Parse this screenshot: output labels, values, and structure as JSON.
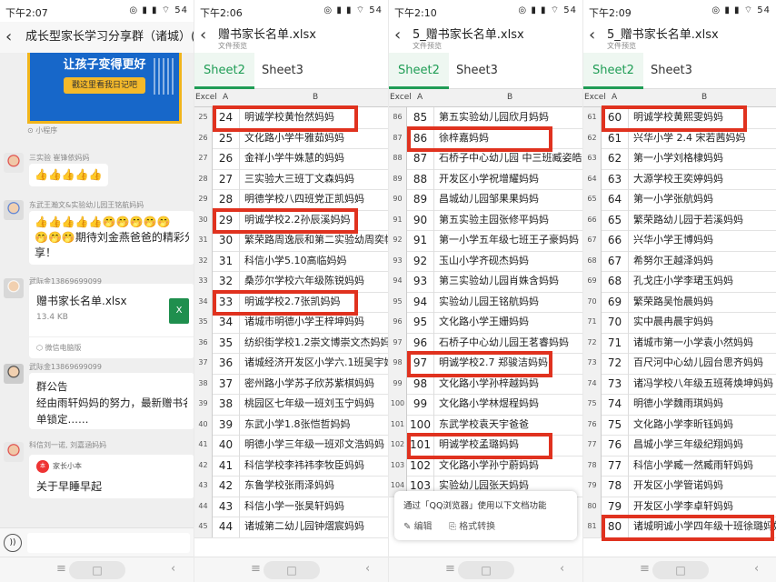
{
  "chat": {
    "status_time": "下午2:07",
    "title": "成长型家长学习分享群（诸城）(49",
    "banner_line1": "让孩子变得更好",
    "banner_btn": "戳这里看我日记吧",
    "mini_program": "小程序",
    "msg1_sender": "三实验 崔锋依妈妈",
    "msg1_text": "👍👍👍👍👍",
    "msg2_sender": "东武王瀚文&实验幼儿园王铭航妈妈",
    "msg2_line1": "👍👍👍👍👍🤭🤭🤭🤭🤭",
    "msg2_line2": "🤭🤭🤭期待刘金燕爸爸的精彩分",
    "msg2_line3": "享！",
    "msg3_sender": "武际金13869699099",
    "file_name": "赠书家长名单.xlsx",
    "file_size": "13.4 KB",
    "file_source": "微信电脑版",
    "msg4_sender": "武际金13869699099",
    "notice_title": "群公告",
    "notice_line1": "经由雨轩妈妈的努力，最新赠书名",
    "notice_line2": "单锁定……",
    "msg5_sender": "科信刘一诺, 刘嘉涵妈妈",
    "card_brand": "家长小本",
    "card_title": "关于早睡早起"
  },
  "sheets": [
    {
      "status_time": "下午2:06",
      "file_name": "赠书家长名单.xlsx",
      "file_sub": "文件预览",
      "tabs": [
        "Sheet2",
        "Sheet3"
      ],
      "rows": [
        {
          "r": "25",
          "a": "24",
          "b": "明诚学校黄怡然妈妈"
        },
        {
          "r": "26",
          "a": "25",
          "b": "文化路小学牛雅茹妈妈"
        },
        {
          "r": "27",
          "a": "26",
          "b": "金祥小学牛姝慧的妈妈"
        },
        {
          "r": "28",
          "a": "27",
          "b": "三实验大三班丁文森妈妈"
        },
        {
          "r": "29",
          "a": "28",
          "b": "明德学校八四班党正凯妈妈"
        },
        {
          "r": "30",
          "a": "29",
          "b": "明诚学校2.2孙辰溪妈妈"
        },
        {
          "r": "31",
          "a": "30",
          "b": "繁荣路周逸辰和第二实验幼周奕帆"
        },
        {
          "r": "32",
          "a": "31",
          "b": "科信小学5.10高临妈妈"
        },
        {
          "r": "33",
          "a": "32",
          "b": "桑莎尔学校六年级陈锐妈妈"
        },
        {
          "r": "34",
          "a": "33",
          "b": "明诚学校2.7张凯妈妈"
        },
        {
          "r": "35",
          "a": "34",
          "b": "诸城市明德小学王梓坤妈妈"
        },
        {
          "r": "36",
          "a": "35",
          "b": "纺织街学校1.2崇文博崇文杰妈妈"
        },
        {
          "r": "37",
          "a": "36",
          "b": "诸城经济开发区小学六.1班吴宇妈"
        },
        {
          "r": "38",
          "a": "37",
          "b": "密州路小学苏子欣苏紫棋妈妈"
        },
        {
          "r": "39",
          "a": "38",
          "b": "桃园区七年级一班刘玉宁妈妈"
        },
        {
          "r": "40",
          "a": "39",
          "b": "东武小学1.8张恺哲妈妈"
        },
        {
          "r": "41",
          "a": "40",
          "b": "明德小学三年级一班邓文浩妈妈"
        },
        {
          "r": "42",
          "a": "41",
          "b": "科信学校李祎祎李牧臣妈妈"
        },
        {
          "r": "43",
          "a": "42",
          "b": "东鲁学校张雨泽妈妈"
        },
        {
          "r": "44",
          "a": "43",
          "b": "科信小学一张昊轩妈妈"
        },
        {
          "r": "45",
          "a": "44",
          "b": "诸城第二幼儿园钟熠宸妈妈"
        }
      ]
    },
    {
      "status_time": "下午2:10",
      "file_name": "5_赠书家长名单.xlsx",
      "file_sub": "文件预览",
      "tabs": [
        "Sheet2",
        "Sheet3"
      ],
      "rows": [
        {
          "r": "86",
          "a": "85",
          "b": "第五实验幼儿园欣月妈妈"
        },
        {
          "r": "87",
          "a": "86",
          "b": "徐梓嘉妈妈"
        },
        {
          "r": "88",
          "a": "87",
          "b": "石桥子中心幼儿园 中三班臧姿皓妈"
        },
        {
          "r": "89",
          "a": "88",
          "b": "开发区小学祝增耀妈妈"
        },
        {
          "r": "90",
          "a": "89",
          "b": "昌城幼儿园邹果果妈妈"
        },
        {
          "r": "91",
          "a": "90",
          "b": "第五实验主园张修平妈妈"
        },
        {
          "r": "92",
          "a": "91",
          "b": "第一小学五年级七班王子豪妈妈"
        },
        {
          "r": "93",
          "a": "92",
          "b": "玉山小学齐砚杰妈妈"
        },
        {
          "r": "94",
          "a": "93",
          "b": "第三实验幼儿园肖姝含妈妈"
        },
        {
          "r": "95",
          "a": "94",
          "b": "实验幼儿园王铭航妈妈"
        },
        {
          "r": "96",
          "a": "95",
          "b": "文化路小学王姗妈妈"
        },
        {
          "r": "97",
          "a": "96",
          "b": "石桥子中心幼儿园王茗睿妈妈"
        },
        {
          "r": "98",
          "a": "97",
          "b": "明诚学校2.7 郑骏洁妈妈"
        },
        {
          "r": "99",
          "a": "98",
          "b": "文化路小学孙梓越妈妈"
        },
        {
          "r": "100",
          "a": "99",
          "b": "文化路小学林煜程妈妈"
        },
        {
          "r": "101",
          "a": "100",
          "b": "东武学校袁天宇爸爸"
        },
        {
          "r": "102",
          "a": "101",
          "b": "明诚学校孟璐妈妈"
        },
        {
          "r": "103",
          "a": "102",
          "b": "文化路小学孙宁蔚妈妈"
        },
        {
          "r": "104",
          "a": "103",
          "b": "实验幼儿园张天妈妈"
        }
      ],
      "popup_title": "通过「QQ浏览器」使用以下文档功能",
      "popup_edit": "编辑",
      "popup_convert": "格式转换"
    },
    {
      "status_time": "下午2:09",
      "file_name": "5_赠书家长名单.xlsx",
      "file_sub": "文件预览",
      "tabs": [
        "Sheet2",
        "Sheet3"
      ],
      "rows": [
        {
          "r": "61",
          "a": "60",
          "b": "明诚学校黄熙雯妈妈"
        },
        {
          "r": "62",
          "a": "61",
          "b": "兴华小学  2.4 宋若茜妈妈"
        },
        {
          "r": "63",
          "a": "62",
          "b": "第一小学刘格棣妈妈"
        },
        {
          "r": "64",
          "a": "63",
          "b": "大源学校王奕婷妈妈"
        },
        {
          "r": "65",
          "a": "64",
          "b": "第一小学张航妈妈"
        },
        {
          "r": "66",
          "a": "65",
          "b": "繁荣路幼儿园于若溪妈妈"
        },
        {
          "r": "67",
          "a": "66",
          "b": "兴华小学王博妈妈"
        },
        {
          "r": "68",
          "a": "67",
          "b": "希努尔王越泽妈妈"
        },
        {
          "r": "69",
          "a": "68",
          "b": "孔戈庄小学李珺玉妈妈"
        },
        {
          "r": "70",
          "a": "69",
          "b": "繁荣路吴怡晨妈妈"
        },
        {
          "r": "71",
          "a": "70",
          "b": "实中晨冉晨宇妈妈"
        },
        {
          "r": "72",
          "a": "71",
          "b": "诸城市第一小学袁小然妈妈"
        },
        {
          "r": "73",
          "a": "72",
          "b": "百尺河中心幼儿园台思齐妈妈"
        },
        {
          "r": "74",
          "a": "73",
          "b": "诸冯学校八年级五班蒋焕坤妈妈"
        },
        {
          "r": "75",
          "a": "74",
          "b": "明德小学魏雨琪妈妈"
        },
        {
          "r": "76",
          "a": "75",
          "b": "文化路小学李昕钰妈妈"
        },
        {
          "r": "77",
          "a": "76",
          "b": "昌城小学三年级纪翔妈妈"
        },
        {
          "r": "78",
          "a": "77",
          "b": "科信小学臧一然臧雨轩妈妈"
        },
        {
          "r": "79",
          "a": "78",
          "b": "开发区小学管诺妈妈"
        },
        {
          "r": "80",
          "a": "79",
          "b": "开发区小学李卓轩妈妈"
        },
        {
          "r": "81",
          "a": "80",
          "b": "诸城明诚小学四年级十班徐璐妈妈"
        }
      ]
    }
  ],
  "grid": {
    "corner": "Excel",
    "col_a": "A",
    "col_b": "B"
  },
  "status_icons": "◎ ▮ ▮ ⌔ 54",
  "accent": "#1f9d55",
  "highlight": "#e0321f"
}
